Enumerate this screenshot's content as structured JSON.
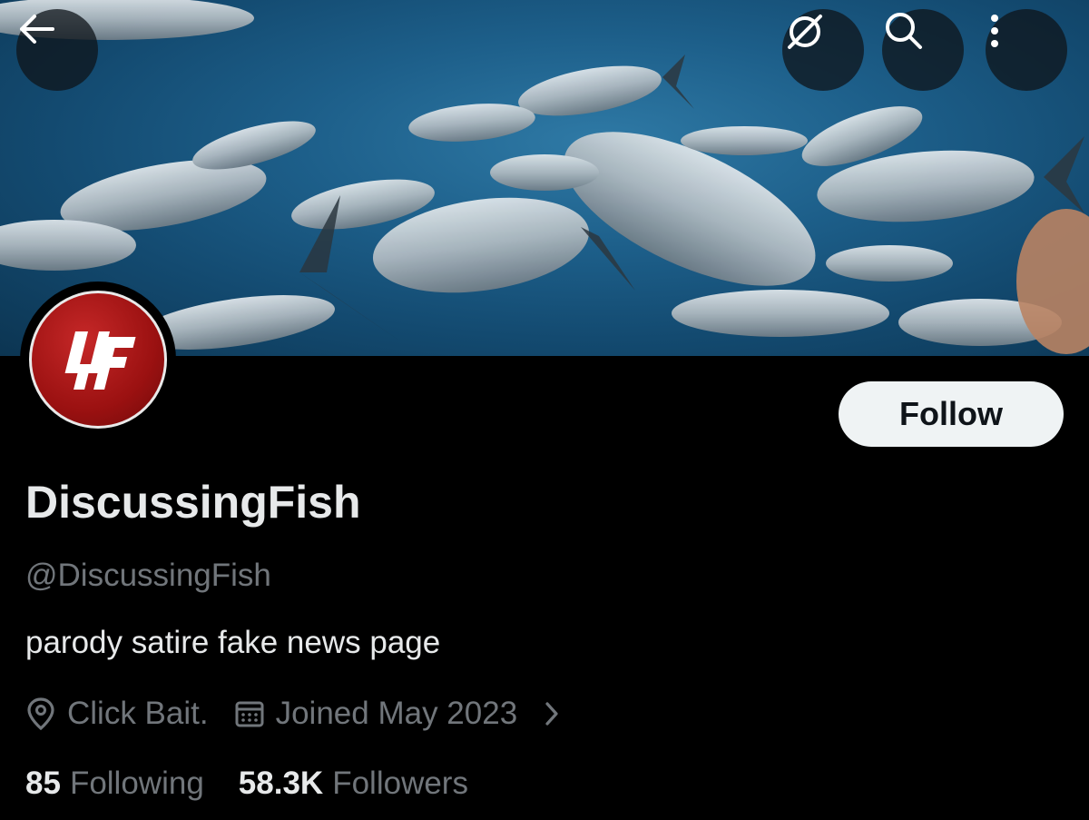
{
  "header": {
    "back_icon": "arrow-left-icon",
    "grok_icon": "grok-slash-icon",
    "search_icon": "search-icon",
    "more_icon": "more-vertical-icon"
  },
  "profile": {
    "avatar_text": "DF",
    "follow_label": "Follow",
    "display_name": "DiscussingFish",
    "handle": "@DiscussingFish",
    "bio": "parody satire fake news page",
    "location": "Click Bait.",
    "joined": "Joined May 2023",
    "following_count": "85",
    "following_label": "Following",
    "followers_count": "58.3K",
    "followers_label": "Followers"
  },
  "colors": {
    "background": "#000000",
    "text_primary": "#e7e9ea",
    "text_secondary": "#71767b",
    "follow_button_bg": "#eff3f4",
    "avatar_red": "#b71c1c"
  }
}
